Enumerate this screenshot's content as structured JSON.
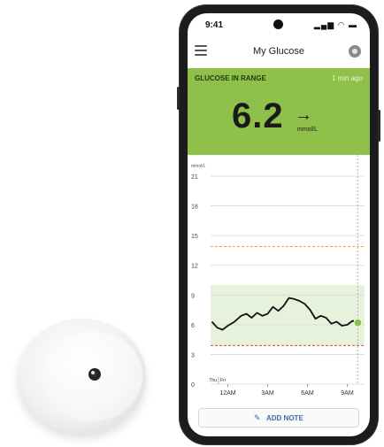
{
  "status_bar": {
    "time": "9:41",
    "icons": "▂▄▆ ◠ ▬"
  },
  "app_bar": {
    "title": "My Glucose",
    "menu_icon": "menu-icon",
    "sound_icon": "sound-icon"
  },
  "banner": {
    "label": "GLUCOSE IN RANGE",
    "updated": "1 min ago",
    "value": "6.2",
    "arrow": "→",
    "unit": "mmol/L",
    "color": "#8fc14a"
  },
  "add_note": {
    "label": "ADD NOTE",
    "icon": "pencil-icon"
  },
  "chart_data": {
    "type": "line",
    "unit_label": "mmol/L",
    "y_ticks": [
      0,
      3,
      6,
      9,
      12,
      15,
      18,
      21
    ],
    "ylim": [
      0,
      21
    ],
    "x_ticks": [
      "12AM",
      "3AM",
      "6AM",
      "9AM"
    ],
    "x_tick_hours": [
      1,
      4,
      7,
      10
    ],
    "xlim": [
      -0.3,
      11.3
    ],
    "day_labels": [
      "Thu",
      "Fri"
    ],
    "day_boundary_hour": 0.3,
    "target_range": [
      3.9,
      10.0
    ],
    "high_threshold": 13.9,
    "low_threshold": 3.9,
    "range_color": "#e7f2dc",
    "line_color": "#111111",
    "high_color": "#f2a23a",
    "low_color": "#e0443a",
    "current_point_color": "#8fc14a",
    "grid": true,
    "series": [
      {
        "x": [
          -0.2,
          0.2,
          0.6,
          1.0,
          1.5,
          2.0,
          2.4,
          2.8,
          3.2,
          3.6,
          4.0,
          4.4,
          4.8,
          5.2,
          5.6,
          6.0,
          6.4,
          6.8,
          7.2,
          7.6,
          8.0,
          8.4,
          8.8,
          9.2,
          9.6,
          10.0,
          10.4,
          10.8
        ],
        "values": [
          6.3,
          5.7,
          5.5,
          5.9,
          6.3,
          6.9,
          7.1,
          6.7,
          7.2,
          6.9,
          7.1,
          7.8,
          7.4,
          7.9,
          8.7,
          8.6,
          8.4,
          8.1,
          7.5,
          6.6,
          6.9,
          6.7,
          6.1,
          6.3,
          5.9,
          6.0,
          6.4,
          6.2
        ]
      }
    ]
  }
}
